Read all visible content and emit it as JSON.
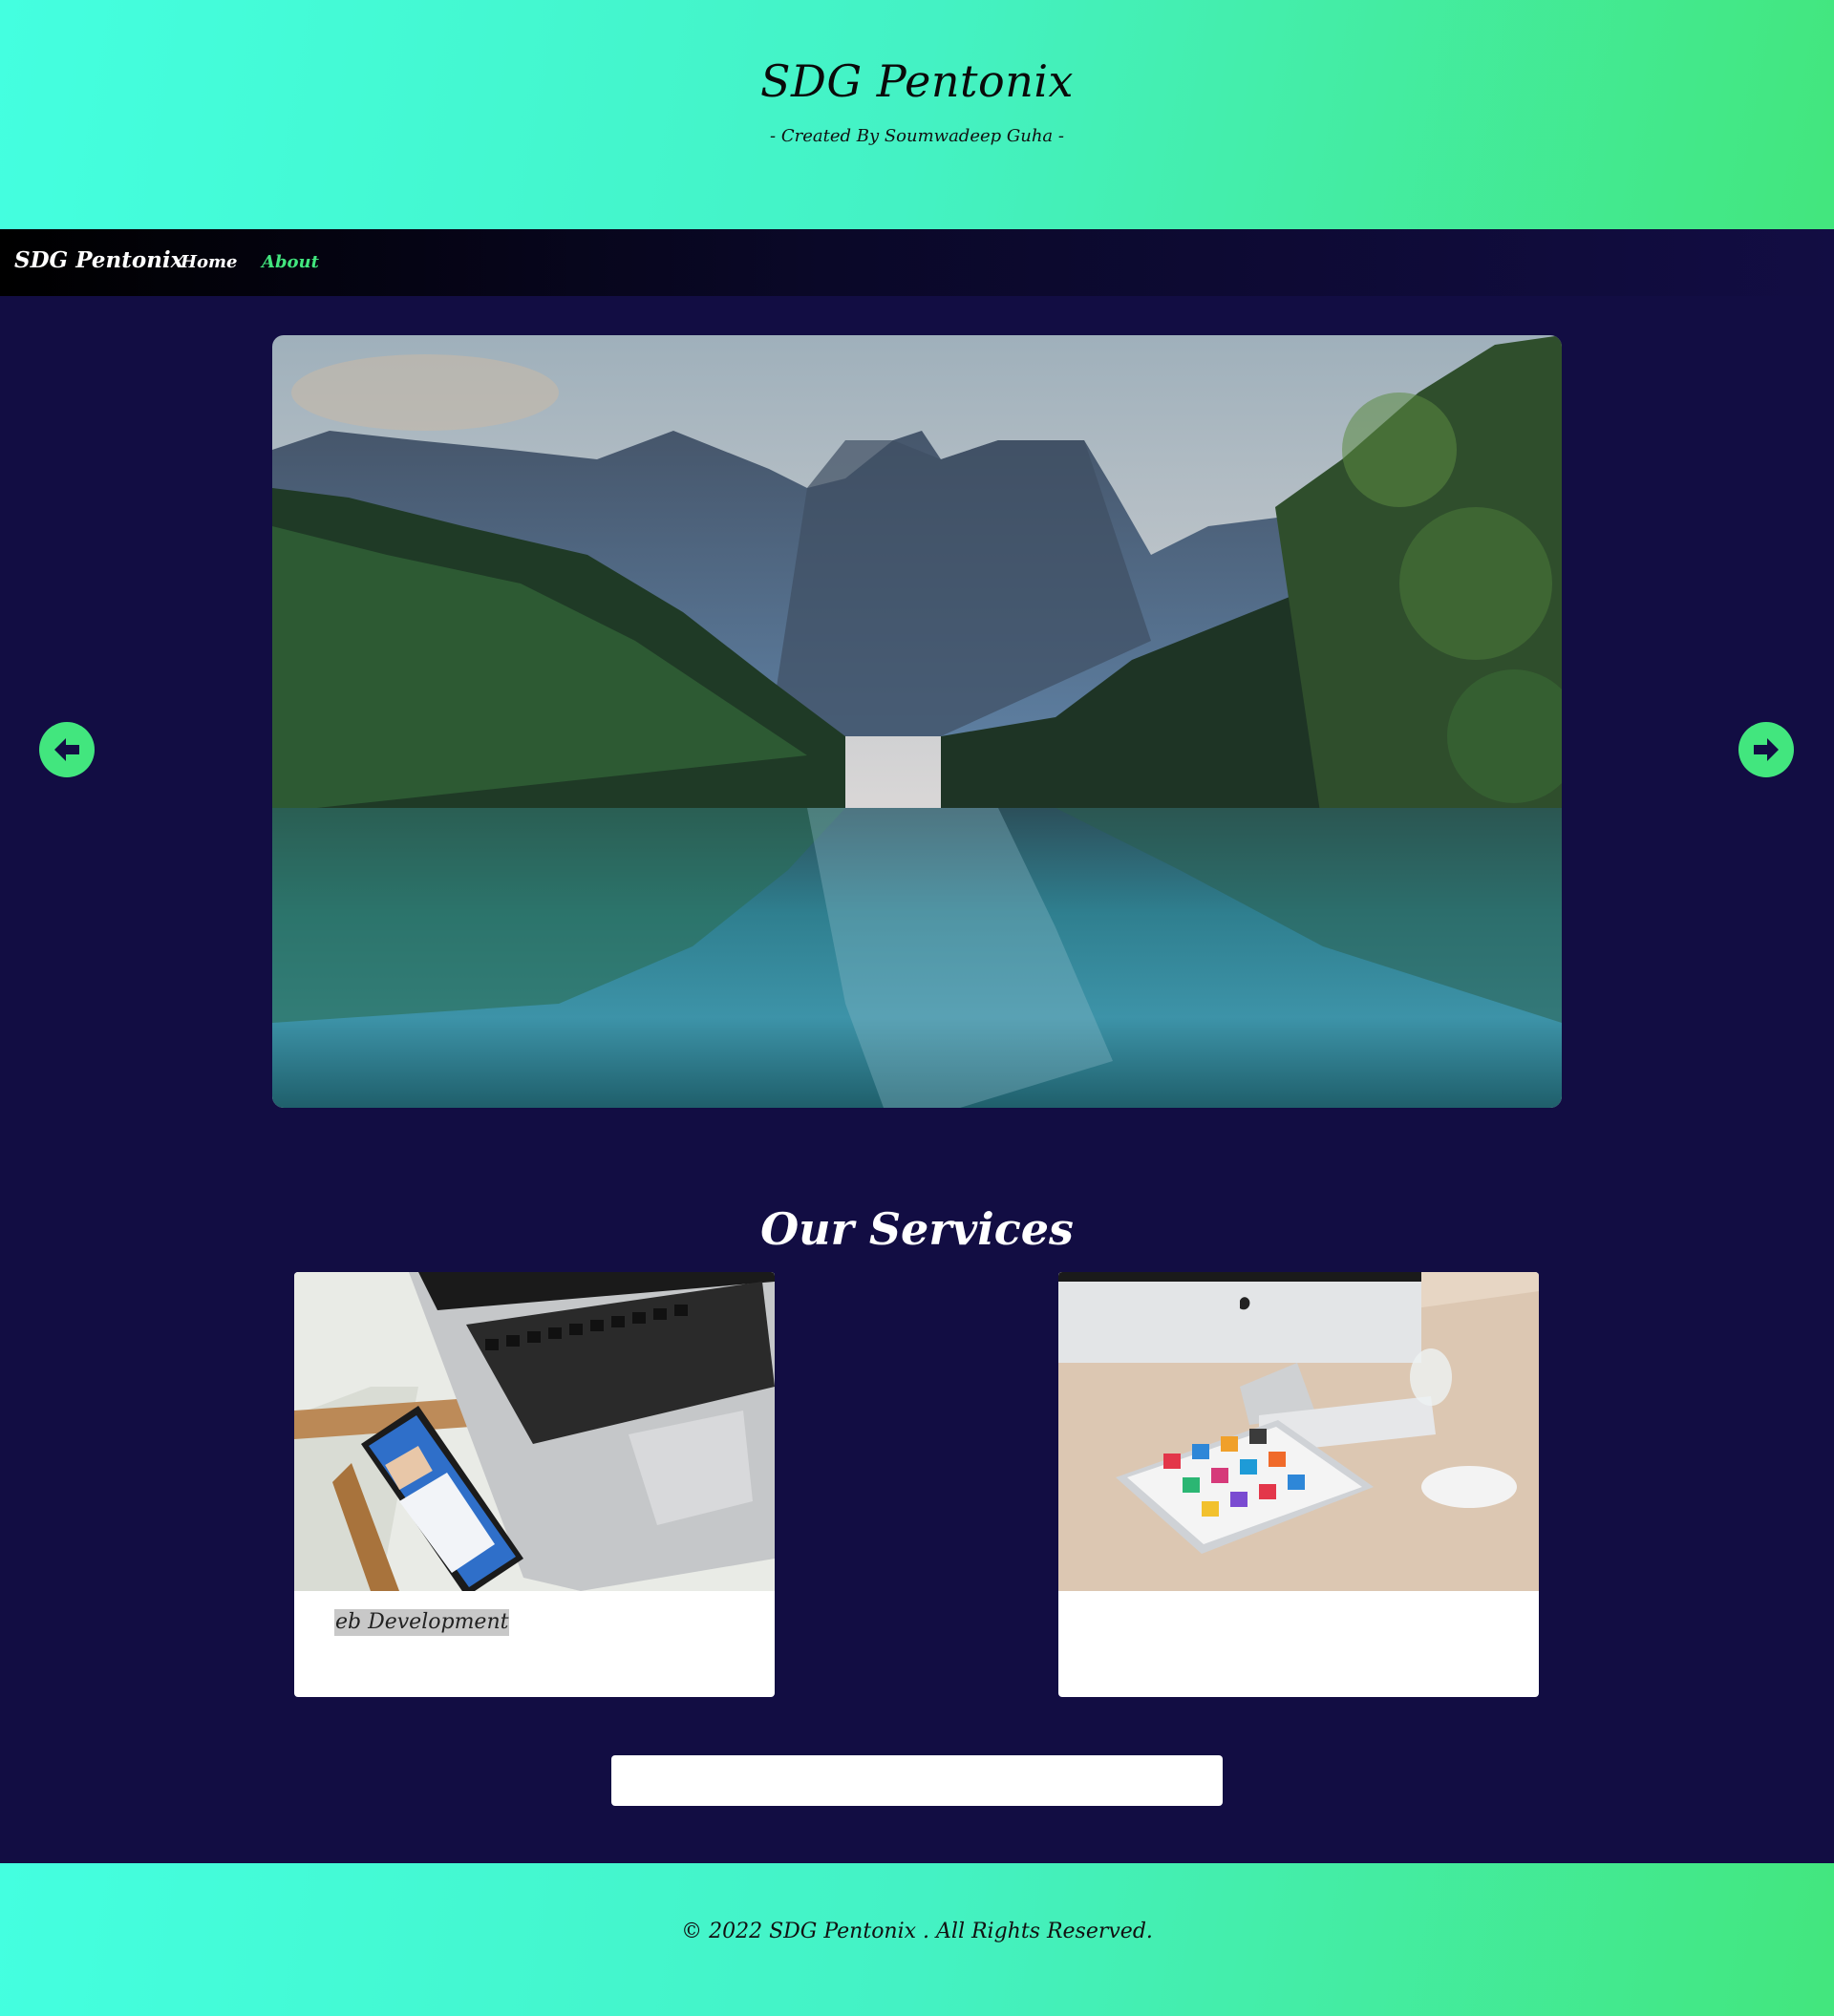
{
  "header": {
    "title": "SDG Pentonix",
    "subtitle": "- Created By Soumwadeep Guha -"
  },
  "nav": {
    "brand": "SDG Pentonix",
    "links": [
      {
        "label": "Home",
        "active": false
      },
      {
        "label": "About",
        "active": true
      }
    ]
  },
  "carousel": {
    "prev_icon": "arrow-left-circle-icon",
    "next_icon": "arrow-right-circle-icon"
  },
  "services": {
    "title": "Our Services",
    "cards": [
      {
        "caption": "eb Development"
      },
      {
        "caption": ""
      }
    ]
  },
  "footer": {
    "copyright": "© 2022 SDG Pentonix . All Rights Reserved."
  },
  "colors": {
    "accent": "#42e67e",
    "background": "#120d43",
    "header_gradient_start": "#44ffe0",
    "header_gradient_end": "#43e67d"
  }
}
